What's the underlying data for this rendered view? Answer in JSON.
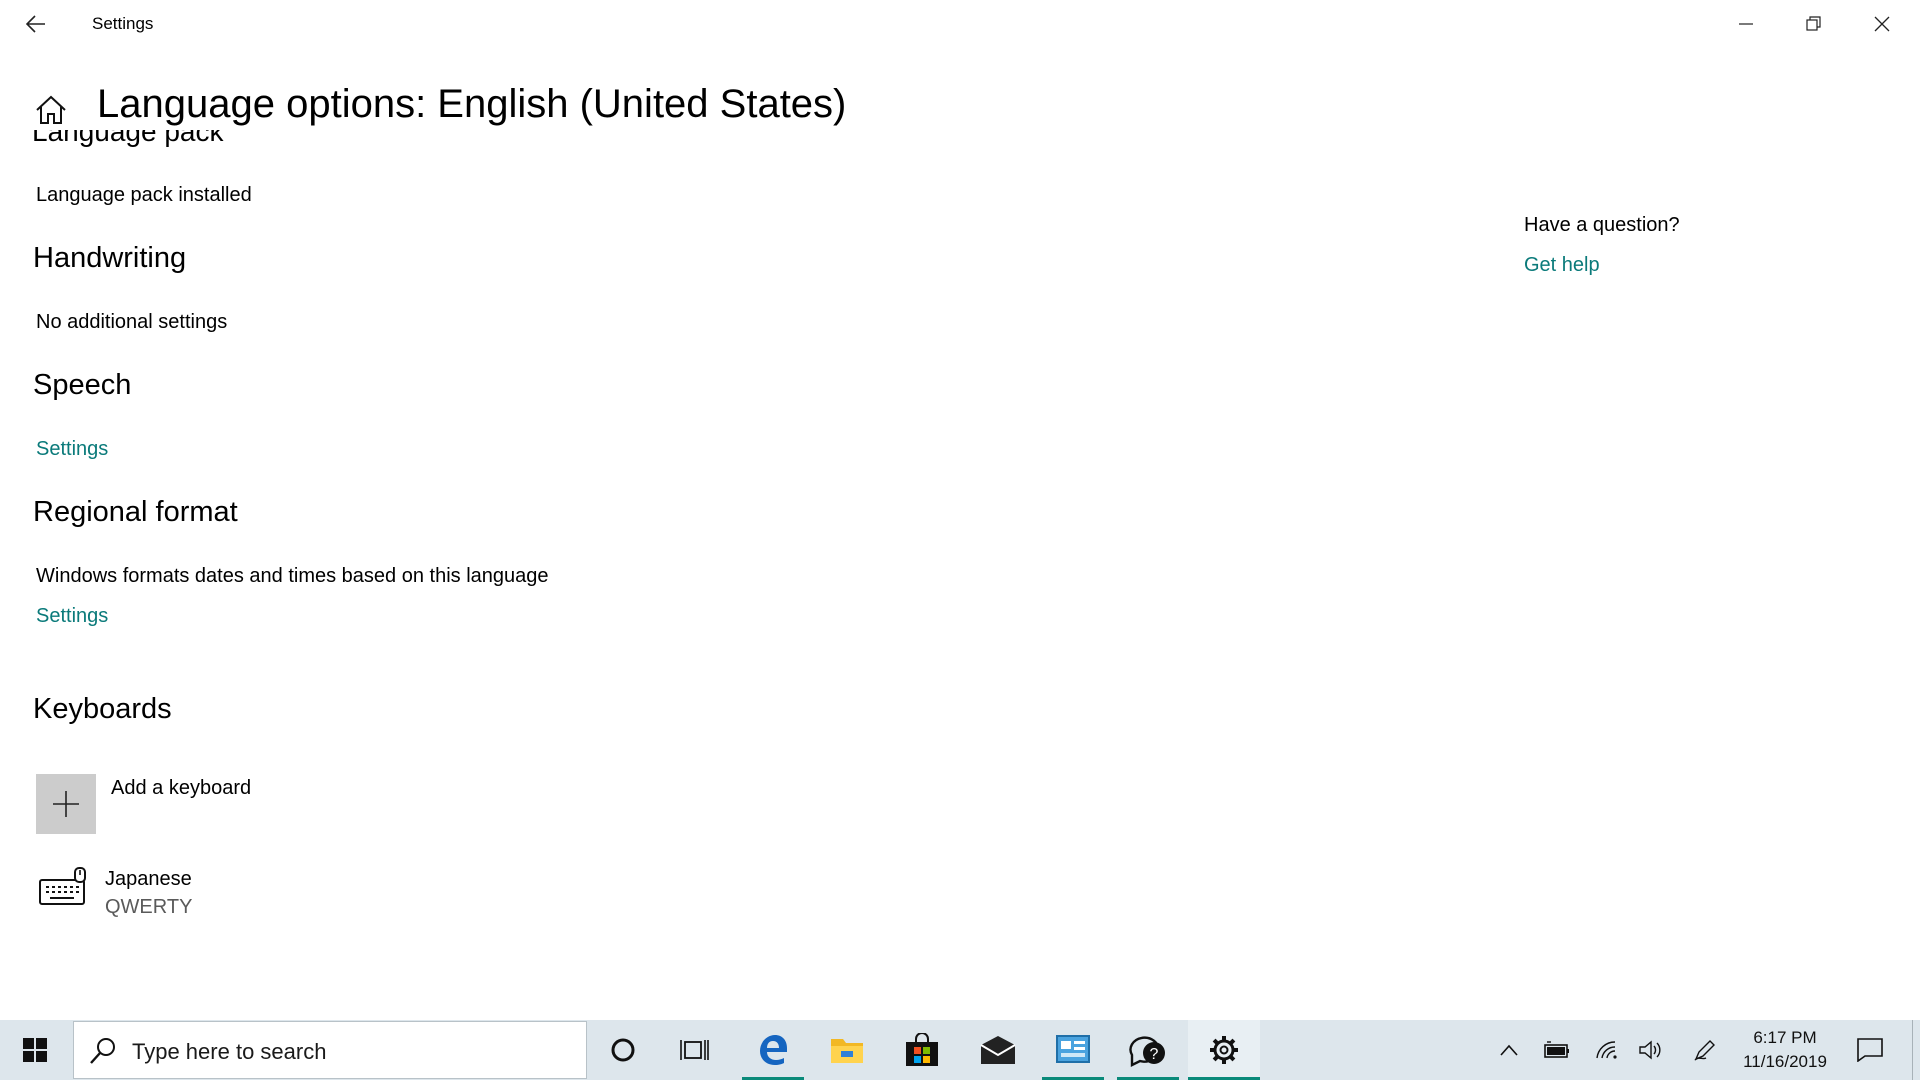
{
  "window": {
    "title": "Settings"
  },
  "header": {
    "page_title": "Language options: English (United States)",
    "clipped_heading": "Language pack"
  },
  "sections": {
    "language_pack_status": "Language pack installed",
    "handwriting": {
      "heading": "Handwriting",
      "text": "No additional settings"
    },
    "speech": {
      "heading": "Speech",
      "settings_link": "Settings"
    },
    "regional_format": {
      "heading": "Regional format",
      "text": "Windows formats dates and times based on this language",
      "settings_link": "Settings"
    },
    "keyboards": {
      "heading": "Keyboards",
      "add_label": "Add a keyboard",
      "items": [
        {
          "name": "Japanese",
          "layout": "QWERTY"
        }
      ]
    }
  },
  "sidebar": {
    "question": "Have a question?",
    "help_link": "Get help"
  },
  "taskbar": {
    "search_placeholder": "Type here to search",
    "clock_time": "6:17 PM",
    "clock_date": "11/16/2019",
    "apps": [
      "cortana-icon",
      "task-view-icon",
      "edge-icon",
      "file-explorer-icon",
      "store-icon",
      "mail-icon",
      "control-panel-icon",
      "feedback-hub-icon",
      "settings-icon"
    ]
  },
  "colors": {
    "accent_link": "#0a7a7a",
    "taskbar_bg": "#dde6ec",
    "taskbar_active": "#0a8a7a"
  }
}
